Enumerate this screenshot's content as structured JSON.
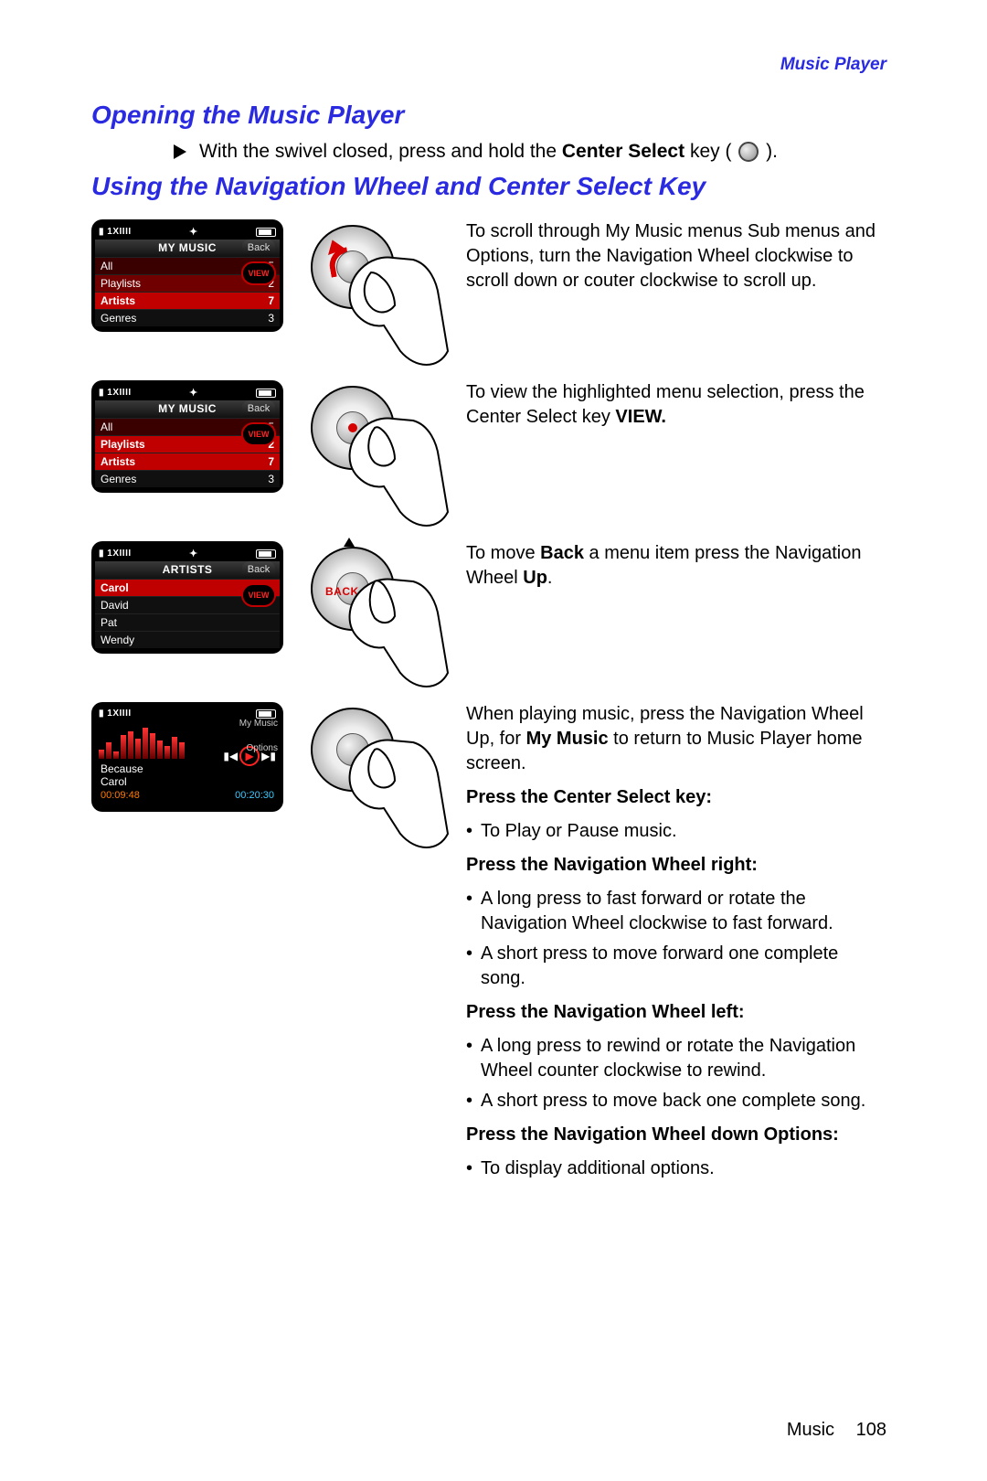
{
  "header": {
    "section": "Music Player"
  },
  "h_open": "Opening the Music Player",
  "open_line_a": "With the swivel closed, press and hold the ",
  "open_line_b": "Center Select",
  "open_line_c": " key (",
  "open_line_d": ").",
  "h_nav": "Using the Navigation Wheel and Center Select Key",
  "screen1": {
    "title": "MY MUSIC",
    "status": "1XIIII",
    "rows": [
      {
        "label": "All",
        "count": "15"
      },
      {
        "label": "Playlists",
        "count": "2"
      },
      {
        "label": "Artists",
        "count": "7"
      },
      {
        "label": "Genres",
        "count": "3"
      }
    ],
    "back": "Back",
    "view": "VIEW"
  },
  "desc1": "To scroll through My Music menus Sub menus and Options, turn the Navigation Wheel clockwise to scroll down or couter clockwise to scroll up.",
  "screen2": {
    "title": "MY MUSIC",
    "status": "1XIIII",
    "rows": [
      {
        "label": "All",
        "count": "15"
      },
      {
        "label": "Playlists",
        "count": "2"
      },
      {
        "label": "Artists",
        "count": "7"
      },
      {
        "label": "Genres",
        "count": "3"
      }
    ],
    "back": "Back",
    "view": "VIEW"
  },
  "desc2_a": "To view the highlighted menu selection, press the Center Select key ",
  "desc2_b": "VIEW.",
  "screen3": {
    "title": "ARTISTS",
    "status": "1XIIII",
    "rows": [
      {
        "label": "Carol"
      },
      {
        "label": "David"
      },
      {
        "label": "Pat"
      },
      {
        "label": "Wendy"
      }
    ],
    "back": "Back",
    "view": "VIEW",
    "illus_label": "BACK"
  },
  "desc3_a": "To move ",
  "desc3_b": "Back",
  "desc3_c": " a menu item press the Navigation Wheel ",
  "desc3_d": "Up",
  "desc3_e": ".",
  "screen4": {
    "status": "1XIIII",
    "track": "Because",
    "artist": "Carol",
    "elapsed": "00:09:48",
    "total": "00:20:30",
    "my_music": "My Music",
    "options": "Options"
  },
  "desc4_intro_a": "When playing music, press the Navigation Wheel Up, for ",
  "desc4_intro_b": "My Music",
  "desc4_intro_c": " to return to Music Player home screen.",
  "d4_h1": "Press the Center Select key:",
  "d4_h1_i1": "To Play or Pause music.",
  "d4_h2": "Press the Navigation Wheel right:",
  "d4_h2_i1": "A long press to fast forward or rotate the Navigation Wheel clockwise to fast forward.",
  "d4_h2_i2": "A short press to move forward one complete song.",
  "d4_h3": "Press the Navigation Wheel left:",
  "d4_h3_i1": "A long press to rewind or rotate the Navigation Wheel counter clockwise to rewind.",
  "d4_h3_i2": "A short press to move back one complete song.",
  "d4_h4": "Press the Navigation Wheel down Options:",
  "d4_h4_i1": "To display additional options.",
  "footer": {
    "section": "Music",
    "page": "108"
  }
}
